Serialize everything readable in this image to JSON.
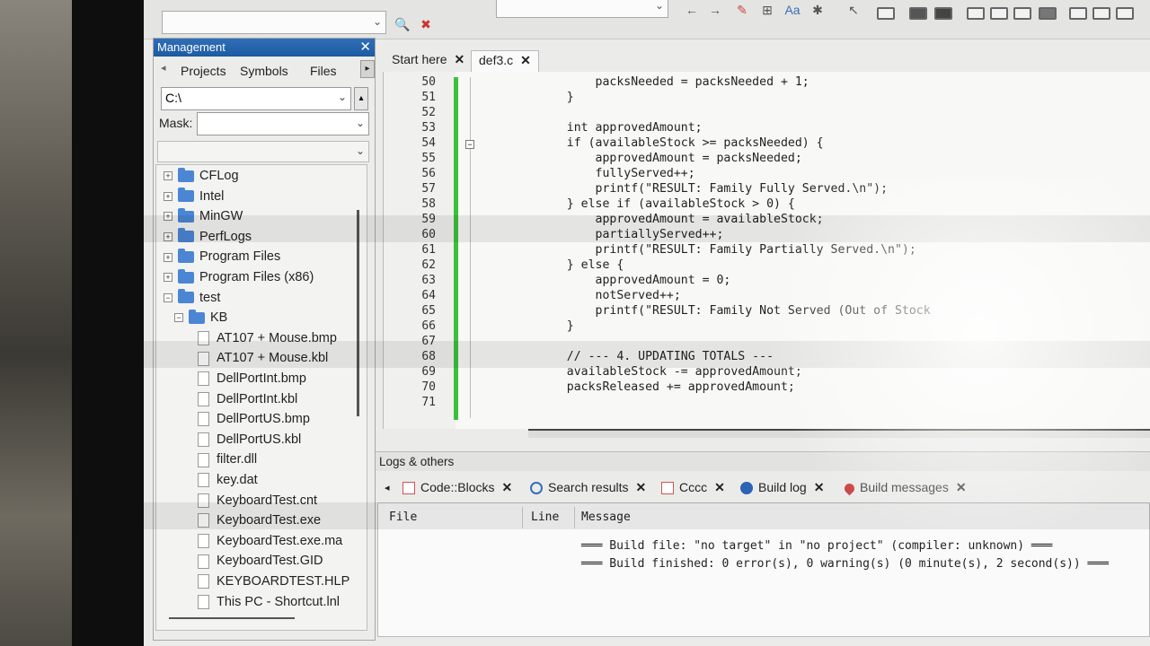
{
  "management": {
    "title": "Management",
    "tabs": [
      "Projects",
      "Symbols",
      "Files"
    ],
    "path": "C:\\",
    "mask_label": "Mask:",
    "tree": [
      {
        "label": "CFLog",
        "type": "folder",
        "expander": "+"
      },
      {
        "label": "Intel",
        "type": "folder",
        "expander": "+"
      },
      {
        "label": "MinGW",
        "type": "folder",
        "expander": "+"
      },
      {
        "label": "PerfLogs",
        "type": "folder",
        "expander": "+"
      },
      {
        "label": "Program Files",
        "type": "folder",
        "expander": "+"
      },
      {
        "label": "Program Files (x86)",
        "type": "folder",
        "expander": "+"
      },
      {
        "label": "test",
        "type": "folder",
        "expander": "−"
      },
      {
        "label": "KB",
        "type": "folder",
        "expander": "−"
      },
      {
        "label": "AT107 + Mouse.bmp",
        "type": "file"
      },
      {
        "label": "AT107 + Mouse.kbl",
        "type": "file"
      },
      {
        "label": "DellPortInt.bmp",
        "type": "file"
      },
      {
        "label": "DellPortInt.kbl",
        "type": "file"
      },
      {
        "label": "DellPortUS.bmp",
        "type": "file"
      },
      {
        "label": "DellPortUS.kbl",
        "type": "file"
      },
      {
        "label": "filter.dll",
        "type": "file"
      },
      {
        "label": "key.dat",
        "type": "file"
      },
      {
        "label": "KeyboardTest.cnt",
        "type": "file"
      },
      {
        "label": "KeyboardTest.exe",
        "type": "file"
      },
      {
        "label": "KeyboardTest.exe.ma",
        "type": "file"
      },
      {
        "label": "KeyboardTest.GID",
        "type": "file"
      },
      {
        "label": "KEYBOARDTEST.HLP",
        "type": "file"
      },
      {
        "label": "This PC - Shortcut.lnl",
        "type": "file"
      }
    ]
  },
  "editor": {
    "tabs": [
      {
        "label": "Start here",
        "active": false
      },
      {
        "label": "def3.c",
        "active": true
      }
    ],
    "lines": [
      {
        "n": "50",
        "code": "        packsNeeded = packsNeeded + 1;"
      },
      {
        "n": "51",
        "code": "    }"
      },
      {
        "n": "52",
        "code": ""
      },
      {
        "n": "53",
        "code": "    int approvedAmount;"
      },
      {
        "n": "54",
        "code": "    if (availableStock >= packsNeeded) {"
      },
      {
        "n": "55",
        "code": "        approvedAmount = packsNeeded;"
      },
      {
        "n": "56",
        "code": "        fullyServed++;"
      },
      {
        "n": "57",
        "code": "        printf(\"RESULT: Family Fully Served.\\n\");"
      },
      {
        "n": "58",
        "code": "    } else if (availableStock > 0) {"
      },
      {
        "n": "59",
        "code": "        approvedAmount = availableStock;"
      },
      {
        "n": "60",
        "code": "        partiallyServed++;"
      },
      {
        "n": "61",
        "code": "        printf(\"RESULT: Family Partially Served.\\n\");"
      },
      {
        "n": "62",
        "code": "    } else {"
      },
      {
        "n": "63",
        "code": "        approvedAmount = 0;"
      },
      {
        "n": "64",
        "code": "        notServed++;"
      },
      {
        "n": "65",
        "code": "        printf(\"RESULT: Family Not Served (Out of Stock"
      },
      {
        "n": "66",
        "code": "    }"
      },
      {
        "n": "67",
        "code": ""
      },
      {
        "n": "68",
        "code": "    // --- 4. UPDATING TOTALS ---"
      },
      {
        "n": "69",
        "code": "    availableStock -= approvedAmount;"
      },
      {
        "n": "70",
        "code": "    packsReleased += approvedAmount;"
      },
      {
        "n": "71",
        "code": ""
      }
    ]
  },
  "logs": {
    "title": "Logs & others",
    "tabs": [
      "Code::Blocks",
      "Search results",
      "Cccc",
      "Build log",
      "Build messages"
    ],
    "columns": [
      "File",
      "Line",
      "Message"
    ],
    "messages": [
      "═══ Build file: \"no target\" in \"no project\" (compiler: unknown) ═══",
      "═══ Build finished: 0 error(s), 0 warning(s) (0 minute(s), 2 second(s)) ═══"
    ]
  },
  "colors": {
    "title_bar": "#1d5aa1",
    "change_bar": "#3cc03c",
    "folder": "#4a86d4"
  }
}
